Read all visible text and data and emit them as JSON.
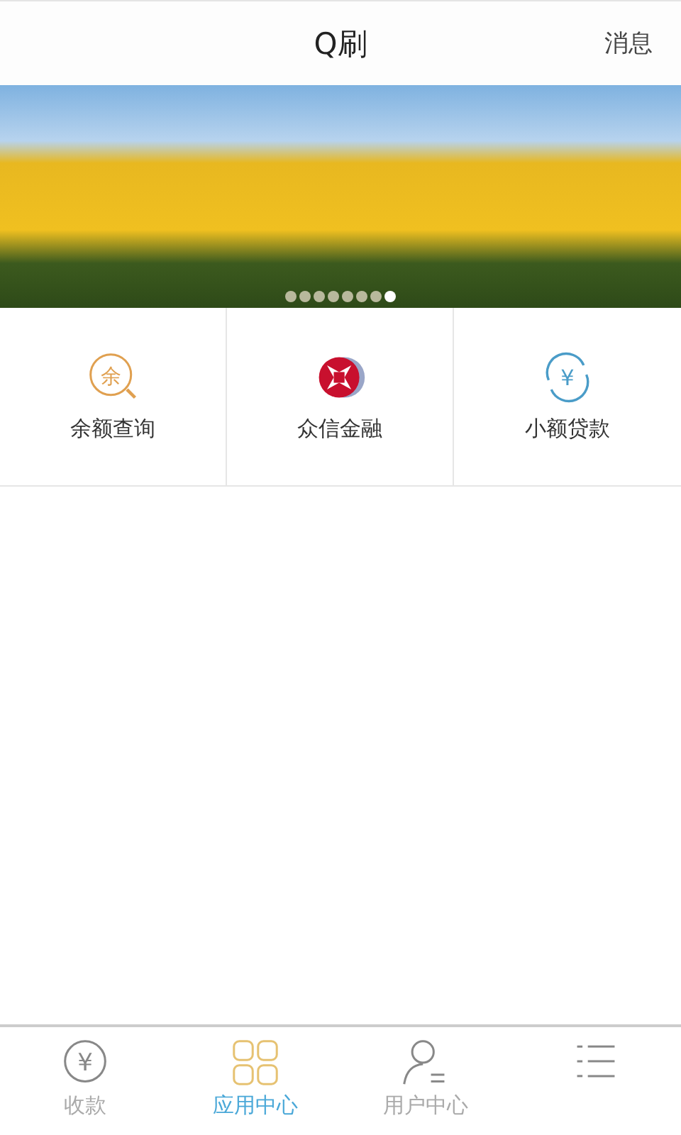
{
  "header": {
    "title": "Q刷",
    "action": "消息"
  },
  "banner": {
    "dots": [
      {
        "selected": false
      },
      {
        "selected": false
      },
      {
        "selected": false
      },
      {
        "selected": false
      },
      {
        "selected": false
      },
      {
        "selected": false
      },
      {
        "selected": false
      },
      {
        "selected": true
      }
    ]
  },
  "apps": [
    {
      "kind": "balance",
      "label": "余额查询",
      "icon_text": "余"
    },
    {
      "kind": "finance",
      "label": "众信金融"
    },
    {
      "kind": "loan",
      "label": "小额贷款",
      "icon_text": "¥"
    }
  ],
  "tabs": [
    {
      "kind": "collect",
      "label": "收款",
      "icon_text": "¥",
      "selected": false
    },
    {
      "kind": "apps",
      "label": "应用中心",
      "selected": true
    },
    {
      "kind": "user",
      "label": "用户中心",
      "selected": false
    },
    {
      "kind": "list",
      "selected": false
    }
  ]
}
